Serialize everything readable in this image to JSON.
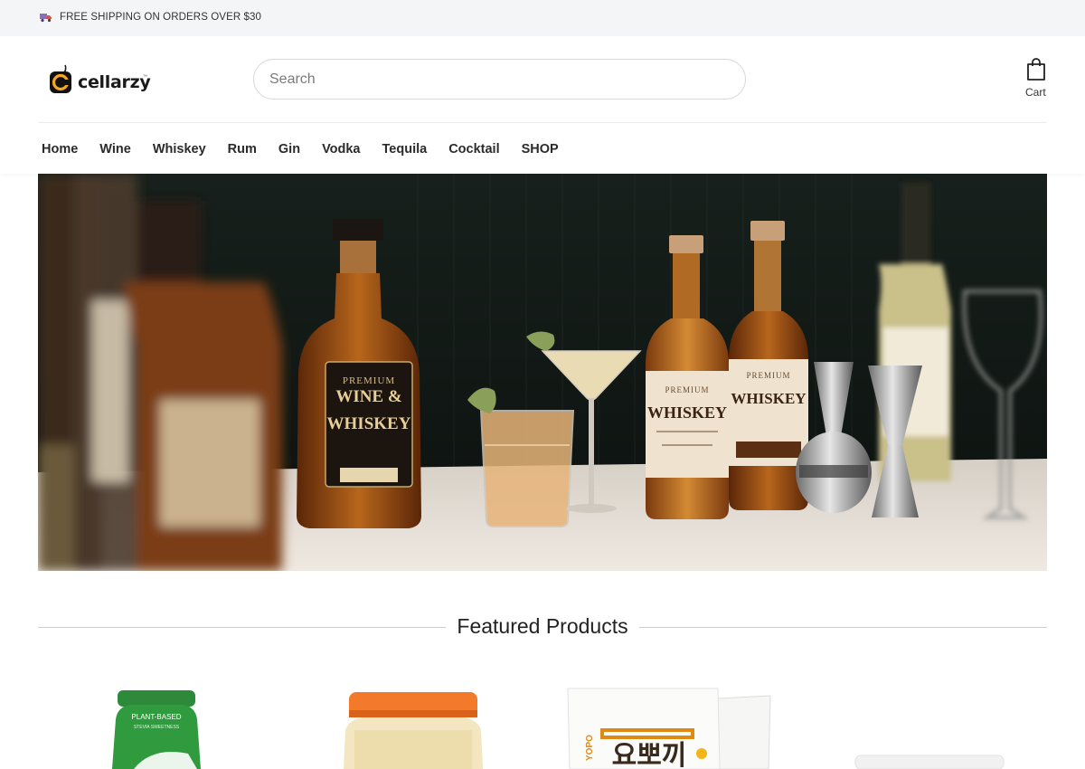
{
  "announcement": {
    "icon": "truck-icon",
    "text": "FREE SHIPPING ON ORDERS OVER $30"
  },
  "header": {
    "logo_text": "cellarzy",
    "logo_tm": "™",
    "search_placeholder": "Search",
    "search_value": "",
    "cart_label": "Cart"
  },
  "nav": {
    "items": [
      "Home",
      "Wine",
      "Whiskey",
      "Rum",
      "Gin",
      "Vodka",
      "Tequila",
      "Cocktail",
      "SHOP"
    ]
  },
  "hero": {
    "bottle_left_label": [
      "PREMIUM",
      "WINE &",
      "WHISKEY"
    ],
    "bottle_mid_label": [
      "PREMIUM",
      "WHISKEY"
    ],
    "bottle_right_label": [
      "PREMIUM",
      "WHISKEY"
    ]
  },
  "featured": {
    "title": "Featured Products",
    "products": [
      {
        "label": "PLANT-BASED",
        "sublabel": "STEVIA SWEETNESS"
      },
      {
        "label": "",
        "sublabel": ""
      },
      {
        "label": "YOPO",
        "sublabel": "요뽀끼"
      },
      {
        "label": "",
        "sublabel": ""
      }
    ]
  },
  "colors": {
    "accent": "#f5a623",
    "topbar_bg": "#f4f5f7",
    "text": "#222222"
  }
}
